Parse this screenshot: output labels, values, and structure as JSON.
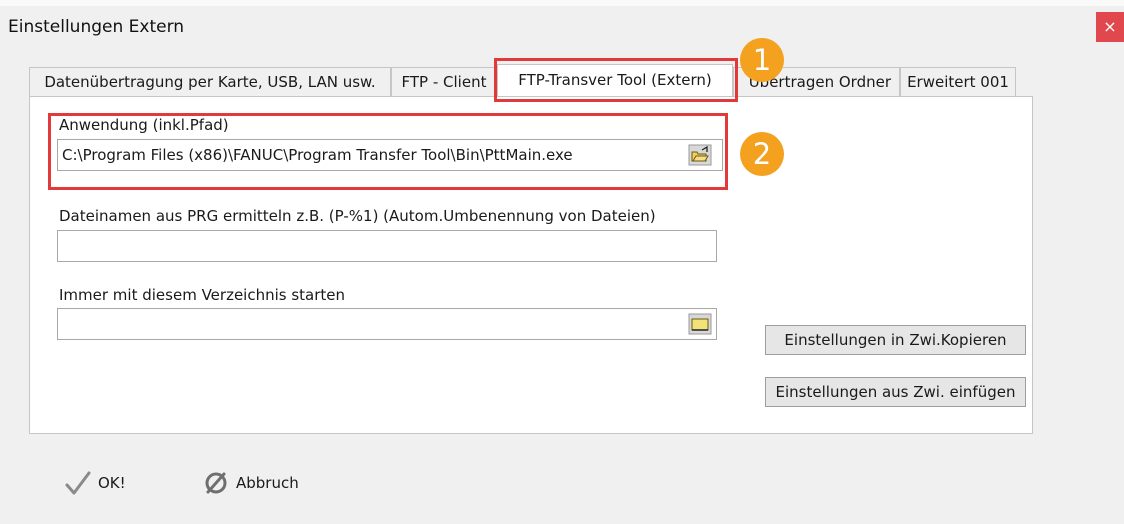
{
  "window": {
    "title": "Einstellungen Extern",
    "close_glyph": "×"
  },
  "tabs": [
    {
      "label": "Datenübertragung per Karte, USB, LAN usw."
    },
    {
      "label": "FTP - Client"
    },
    {
      "label": "FTP-Transver Tool (Extern)"
    },
    {
      "label": "Übertragen Ordner"
    },
    {
      "label": "Erweitert 001"
    }
  ],
  "annotations": {
    "badge_1": "1",
    "badge_2": "2"
  },
  "form": {
    "application_label": "Anwendung (inkl.Pfad)",
    "application_value": "C:\\Program Files (x86)\\FANUC\\Program Transfer Tool\\Bin\\PttMain.exe",
    "filename_label": "Dateinamen aus PRG ermitteln z.B. (P-%1) (Autom.Umbenennung von Dateien)",
    "filename_value": "",
    "directory_label": "Immer mit diesem Verzeichnis starten",
    "directory_value": ""
  },
  "buttons": {
    "copy_settings": "Einstellungen in  Zwi.Kopieren",
    "paste_settings": "Einstellungen aus Zwi. einfügen",
    "ok": "OK!",
    "cancel": "Abbruch"
  },
  "colors": {
    "highlight": "#e2393a",
    "badge": "#f3a11f",
    "close": "#e0484e"
  }
}
